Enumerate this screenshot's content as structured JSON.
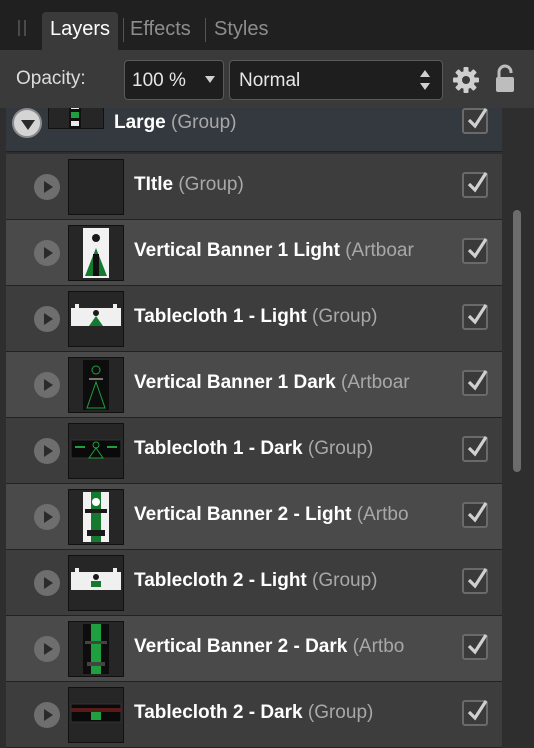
{
  "tabs": [
    {
      "label": "Layers"
    },
    {
      "label": "Effects"
    },
    {
      "label": "Styles"
    }
  ],
  "toolbar": {
    "opacity_label": "Opacity:",
    "opacity_value": "100 %",
    "blend_mode": "Normal"
  },
  "layers": [
    {
      "name": "Large",
      "kind": "(Group)",
      "expanded": true,
      "visible": true
    },
    {
      "name": "TItle",
      "kind": "(Group)",
      "visible": true
    },
    {
      "name": "Vertical Banner 1 Light",
      "kind": "(Artboar",
      "visible": true
    },
    {
      "name": "Tablecloth 1 - Light",
      "kind": "(Group)",
      "visible": true
    },
    {
      "name": "Vertical Banner 1 Dark",
      "kind": "(Artboar",
      "visible": true
    },
    {
      "name": "Tablecloth 1 - Dark",
      "kind": "(Group)",
      "visible": true
    },
    {
      "name": "Vertical Banner 2 - Light",
      "kind": "(Artbo",
      "visible": true
    },
    {
      "name": "Tablecloth 2 - Light",
      "kind": "(Group)",
      "visible": true
    },
    {
      "name": "Vertical Banner 2 - Dark",
      "kind": "(Artbo",
      "visible": true
    },
    {
      "name": "Tablecloth 2 - Dark",
      "kind": "(Group)",
      "visible": true
    }
  ],
  "colors": {
    "panel_bg": "#3d3d3d",
    "row_alt": "#4a4a4a",
    "group_row": "#34393f",
    "accent_green": "#1fa040"
  }
}
